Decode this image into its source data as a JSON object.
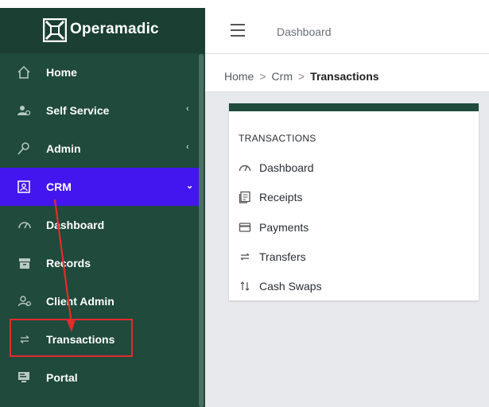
{
  "brand": {
    "name": "Operamadic"
  },
  "header": {
    "title": "Dashboard"
  },
  "breadcrumb": {
    "items": [
      "Home",
      "Crm"
    ],
    "current": "Transactions"
  },
  "sidebar": {
    "items": [
      {
        "label": "Home",
        "icon": "home-icon",
        "chevron": ""
      },
      {
        "label": "Self Service",
        "icon": "user-settings-icon",
        "chevron": "‹"
      },
      {
        "label": "Admin",
        "icon": "key-icon",
        "chevron": "‹"
      },
      {
        "label": "CRM",
        "icon": "contact-card-icon",
        "chevron": "⌄"
      },
      {
        "label": "Dashboard",
        "icon": "gauge-icon",
        "chevron": ""
      },
      {
        "label": "Records",
        "icon": "archive-icon",
        "chevron": ""
      },
      {
        "label": "Client Admin",
        "icon": "user-settings-icon",
        "chevron": ""
      },
      {
        "label": "Transactions",
        "icon": "arrows-left-right-icon",
        "chevron": ""
      },
      {
        "label": "Portal",
        "icon": "monitor-icon",
        "chevron": ""
      }
    ],
    "active_index": 3
  },
  "card": {
    "heading": "TRANSACTIONS",
    "links": [
      {
        "label": "Dashboard",
        "icon": "gauge-icon"
      },
      {
        "label": "Receipts",
        "icon": "receipt-icon"
      },
      {
        "label": "Payments",
        "icon": "credit-card-icon"
      },
      {
        "label": "Transfers",
        "icon": "arrows-left-right-icon"
      },
      {
        "label": "Cash Swaps",
        "icon": "arrows-up-down-icon"
      }
    ]
  },
  "colors": {
    "sidebar_bg": "#1f4a3c",
    "logo_bg": "#1b3f33",
    "active_item": "#4316ef",
    "annotation_red": "#e42b2b"
  }
}
